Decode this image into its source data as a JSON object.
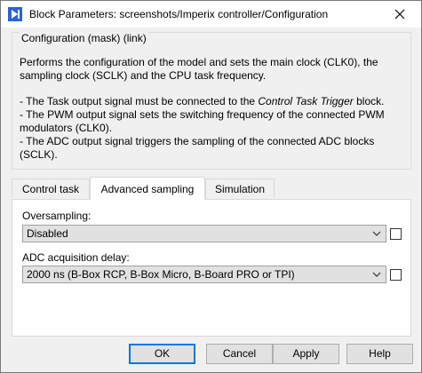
{
  "window": {
    "title": "Block Parameters: screenshots/Imperix controller/Configuration"
  },
  "group": {
    "title": "Configuration (mask) (link)",
    "description": "Performs the configuration of the model and sets the main clock (CLK0), the sampling clock (SCLK) and the CPU task frequency.",
    "bullet1_pre": "- The Task output signal must be connected to the ",
    "bullet1_italic": "Control Task Trigger",
    "bullet1_post": " block.",
    "bullet2": "- The PWM output signal sets the switching frequency of the connected PWM modulators (CLK0).",
    "bullet3": "- The ADC output signal triggers the sampling of the connected ADC blocks (SCLK)."
  },
  "tabs": [
    {
      "label": "Control task",
      "active": false
    },
    {
      "label": "Advanced sampling",
      "active": true
    },
    {
      "label": "Simulation",
      "active": false
    }
  ],
  "fields": {
    "oversampling": {
      "label": "Oversampling:",
      "value": "Disabled",
      "checked": false
    },
    "adc_delay": {
      "label": "ADC acquisition delay:",
      "value": "2000 ns (B-Box RCP, B-Box Micro, B-Board PRO or TPI)",
      "checked": false
    }
  },
  "buttons": {
    "ok": "OK",
    "cancel": "Cancel",
    "apply": "Apply",
    "help": "Help"
  },
  "icons": {
    "app": "simulink-block-icon",
    "close": "close-icon",
    "dropdown": "chevron-down-icon"
  }
}
